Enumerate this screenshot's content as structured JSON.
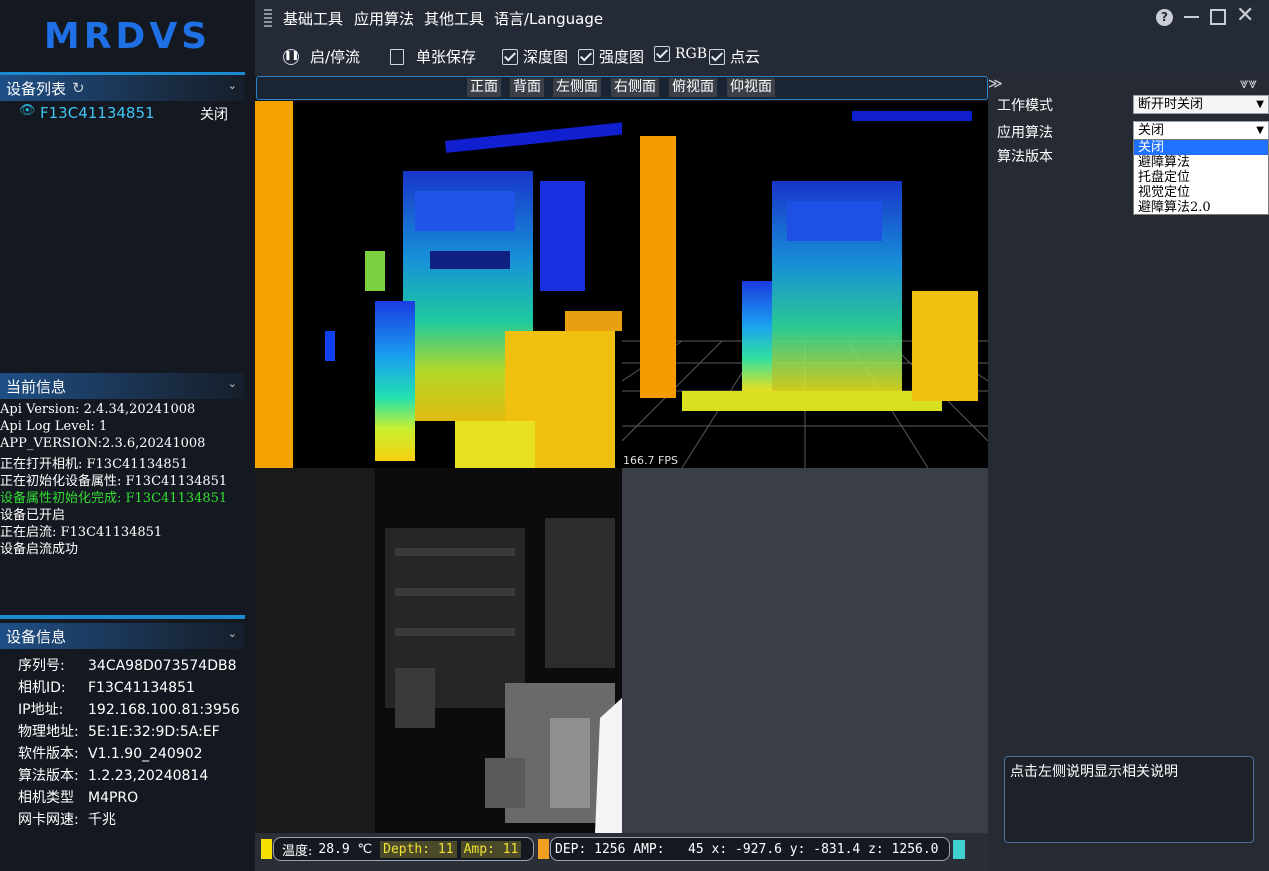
{
  "logo": "MRDVS",
  "menu": {
    "items": [
      "基础工具",
      "应用算法",
      "其他工具",
      "语言/Language"
    ]
  },
  "window_controls": [
    "help",
    "minimize",
    "maximize",
    "close"
  ],
  "toolbar": {
    "stream_label": "启/停流",
    "save_label": "单张保存",
    "checkboxes": [
      {
        "label": "深度图",
        "checked": true
      },
      {
        "label": "强度图",
        "checked": true
      },
      {
        "label": "RGB",
        "checked": true
      },
      {
        "label": "点云",
        "checked": true
      }
    ]
  },
  "views": [
    "正面",
    "背面",
    "左侧面",
    "右侧面",
    "俯视面",
    "仰视面"
  ],
  "device_list": {
    "title": "设备列表",
    "device_id": "F13C41134851",
    "device_status": "关闭"
  },
  "current_info": {
    "title": "当前信息",
    "lines": [
      {
        "text": "Api Version: 2.4.34,20241008",
        "color": "#ffffff"
      },
      {
        "text": "Api Log Level: 1",
        "color": "#ffffff"
      },
      {
        "text": "APP_VERSION:2.3.6,20241008",
        "color": "#ffffff"
      },
      {
        "text": "正在打开相机: F13C41134851",
        "color": "#ffffff"
      },
      {
        "text": "正在初始化设备属性: F13C41134851",
        "color": "#ffffff"
      },
      {
        "text": "设备属性初始化完成: F13C41134851",
        "color": "#33dd33"
      },
      {
        "text": "设备已开启",
        "color": "#ffffff"
      },
      {
        "text": "正在启流: F13C41134851",
        "color": "#ffffff"
      },
      {
        "text": "设备启流成功",
        "color": "#ffffff"
      }
    ]
  },
  "device_info": {
    "title": "设备信息",
    "rows": [
      {
        "key": "序列号:",
        "value": "34CA98D073574DB8"
      },
      {
        "key": "相机ID:",
        "value": "F13C41134851"
      },
      {
        "key": "IP地址:",
        "value": "192.168.100.81:3956"
      },
      {
        "key": "物理地址:",
        "value": "5E:1E:32:9D:5A:EF"
      },
      {
        "key": "软件版本:",
        "value": "V1.1.90_240902"
      },
      {
        "key": "算法版本:",
        "value": "1.2.23,20240814"
      },
      {
        "key": "相机类型",
        "value": "M4PRO"
      },
      {
        "key": "网卡网速:",
        "value": "千兆"
      }
    ]
  },
  "pointcloud": {
    "fps_text": "166.7 FPS"
  },
  "right_panel": {
    "work_mode_label": "工作模式",
    "work_mode_value": "断开时关闭",
    "algo_label": "应用算法",
    "algo_value": "关闭",
    "algo_version_label": "算法版本",
    "algo_options": [
      "关闭",
      "避障算法",
      "托盘定位",
      "视觉定位",
      "避障算法2.0"
    ],
    "algo_selected_index": 0,
    "help_text": "点击左侧说明显示相关说明"
  },
  "status": {
    "temp_label": "温度:",
    "temp_value": "28.9 ℃",
    "depth_text": "Depth: 11",
    "amp_text": "Amp: 11",
    "readout": "DEP: 1256 AMP:   45 x: -927.6 y: -831.4 z: 1256.0",
    "colors": {
      "yellow": "#f5e000",
      "orange": "#f0a020",
      "cyan": "#40d0d0"
    }
  }
}
